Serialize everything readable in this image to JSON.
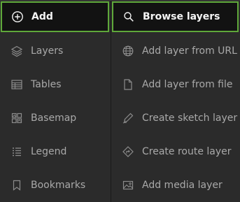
{
  "left_panel": {
    "items": [
      {
        "label": "Add",
        "icon": "plus-circle-icon"
      },
      {
        "label": "Layers",
        "icon": "layers-icon"
      },
      {
        "label": "Tables",
        "icon": "table-icon"
      },
      {
        "label": "Basemap",
        "icon": "basemap-icon"
      },
      {
        "label": "Legend",
        "icon": "legend-icon"
      },
      {
        "label": "Bookmarks",
        "icon": "bookmark-icon"
      }
    ]
  },
  "right_panel": {
    "items": [
      {
        "label": "Browse layers",
        "icon": "search-icon"
      },
      {
        "label": "Add layer from URL",
        "icon": "globe-icon"
      },
      {
        "label": "Add layer from file",
        "icon": "file-icon"
      },
      {
        "label": "Create sketch layer",
        "icon": "sketch-pen-icon"
      },
      {
        "label": "Create route layer",
        "icon": "route-icon"
      },
      {
        "label": "Add media layer",
        "icon": "image-icon"
      }
    ]
  },
  "colors": {
    "background": "#2b2b2b",
    "active_background": "#121212",
    "highlight_border": "#5fa83a",
    "text": "#a9a9a9",
    "active_text": "#f4f4f4"
  }
}
